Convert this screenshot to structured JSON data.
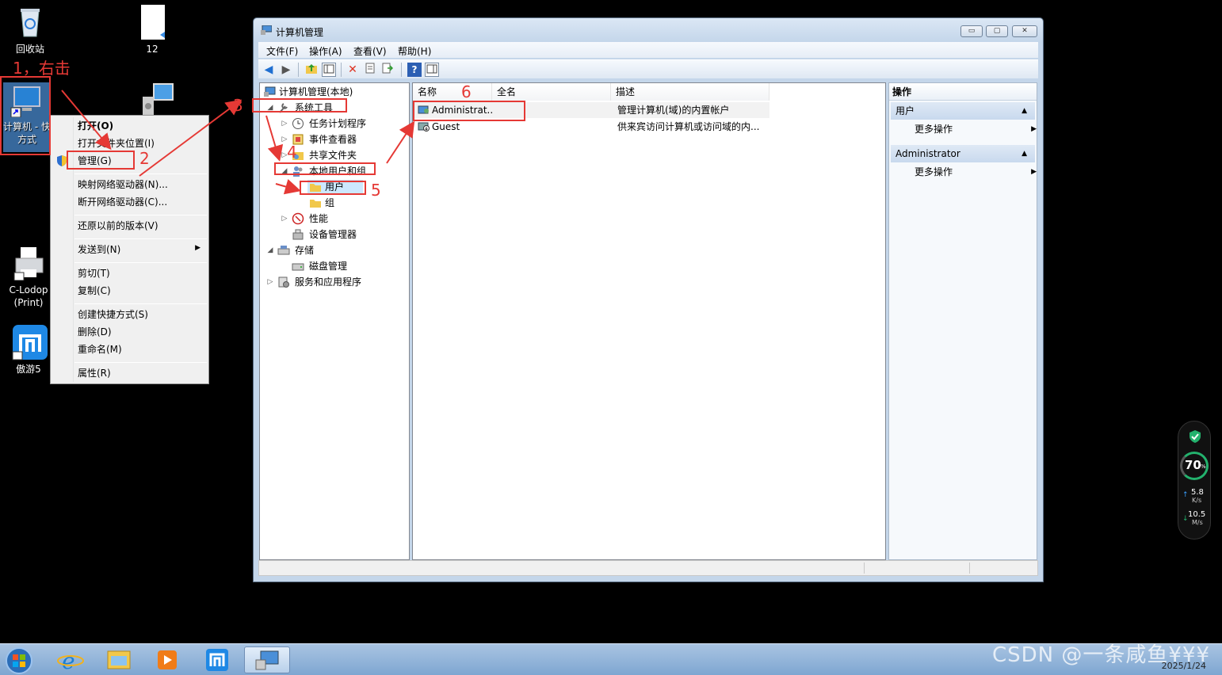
{
  "desktop": {
    "icons": [
      {
        "label": "回收站"
      },
      {
        "label": "12"
      },
      {
        "label": "计算机 - 快方式"
      },
      {
        "label": "C-Lodop (Print)"
      },
      {
        "label": "傲游5"
      }
    ]
  },
  "annotations": {
    "step1": "1，右击",
    "step2": "2",
    "step3": "3",
    "step4": "4",
    "step5": "5",
    "step6": "6"
  },
  "context_menu": {
    "items": [
      "打开(O)",
      "打开文件夹位置(I)",
      "管理(G)",
      "映射网络驱动器(N)...",
      "断开网络驱动器(C)...",
      "还原以前的版本(V)",
      "发送到(N)",
      "剪切(T)",
      "复制(C)",
      "创建快捷方式(S)",
      "删除(D)",
      "重命名(M)",
      "属性(R)"
    ]
  },
  "window": {
    "title": "计算机管理",
    "menus": [
      "文件(F)",
      "操作(A)",
      "查看(V)",
      "帮助(H)"
    ],
    "controls": {
      "minimize": "▭",
      "maximize": "▢",
      "close": "✕"
    }
  },
  "tree": {
    "root": "计算机管理(本地)",
    "items": [
      "系统工具",
      "任务计划程序",
      "事件查看器",
      "共享文件夹",
      "本地用户和组",
      "用户",
      "组",
      "性能",
      "设备管理器",
      "存储",
      "磁盘管理",
      "服务和应用程序"
    ]
  },
  "list": {
    "columns": [
      "名称",
      "全名",
      "描述"
    ],
    "rows": [
      {
        "name": "Administrat...",
        "fullname": "",
        "desc": "管理计算机(域)的内置帐户"
      },
      {
        "name": "Guest",
        "fullname": "",
        "desc": "供来宾访问计算机或访问域的内..."
      }
    ]
  },
  "actions": {
    "header": "操作",
    "sections": [
      {
        "title": "用户",
        "item": "更多操作"
      },
      {
        "title": "Administrator",
        "item": "更多操作"
      }
    ]
  },
  "monitor": {
    "percent": "70",
    "unit": "%",
    "up": "5.8",
    "up_unit": "K/s",
    "down": "10.5",
    "down_unit": "M/s"
  },
  "taskbar": {
    "date": "2025/1/24"
  },
  "watermark": "CSDN @一条咸鱼¥¥¥",
  "colors": {
    "annotation": "#e53935",
    "selection": "#cce8ff"
  }
}
